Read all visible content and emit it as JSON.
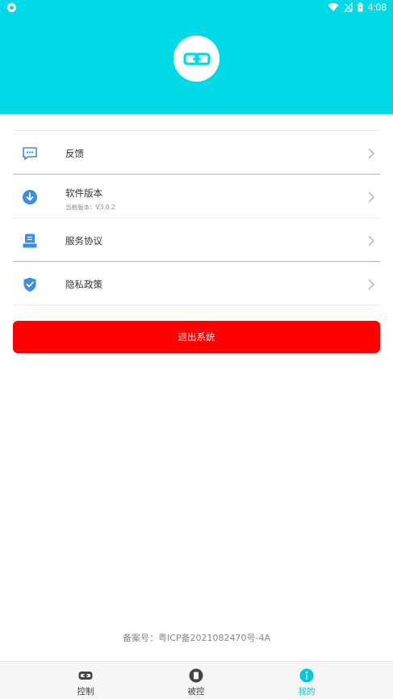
{
  "status_bar": {
    "time": "4:08"
  },
  "colors": {
    "header": "#00d9e6",
    "accent": "#00c8dc",
    "logout": "#ff0000",
    "icon_blue": "#3a8ee6"
  },
  "menu": {
    "items": [
      {
        "label": "反馈",
        "icon": "feedback-icon"
      },
      {
        "label": "软件版本",
        "sublabel": "当前版本：V3.0.2",
        "icon": "download-icon"
      },
      {
        "label": "服务协议",
        "icon": "agreement-icon"
      },
      {
        "label": "隐私政策",
        "icon": "shield-icon"
      }
    ]
  },
  "logout_label": "退出系统",
  "icp_text": "备案号：粤ICP备2021082470号-4A",
  "tabs": [
    {
      "label": "控制",
      "icon": "link-icon",
      "active": false
    },
    {
      "label": "被控",
      "icon": "phone-icon",
      "active": false
    },
    {
      "label": "我的",
      "icon": "info-icon",
      "active": true
    }
  ]
}
